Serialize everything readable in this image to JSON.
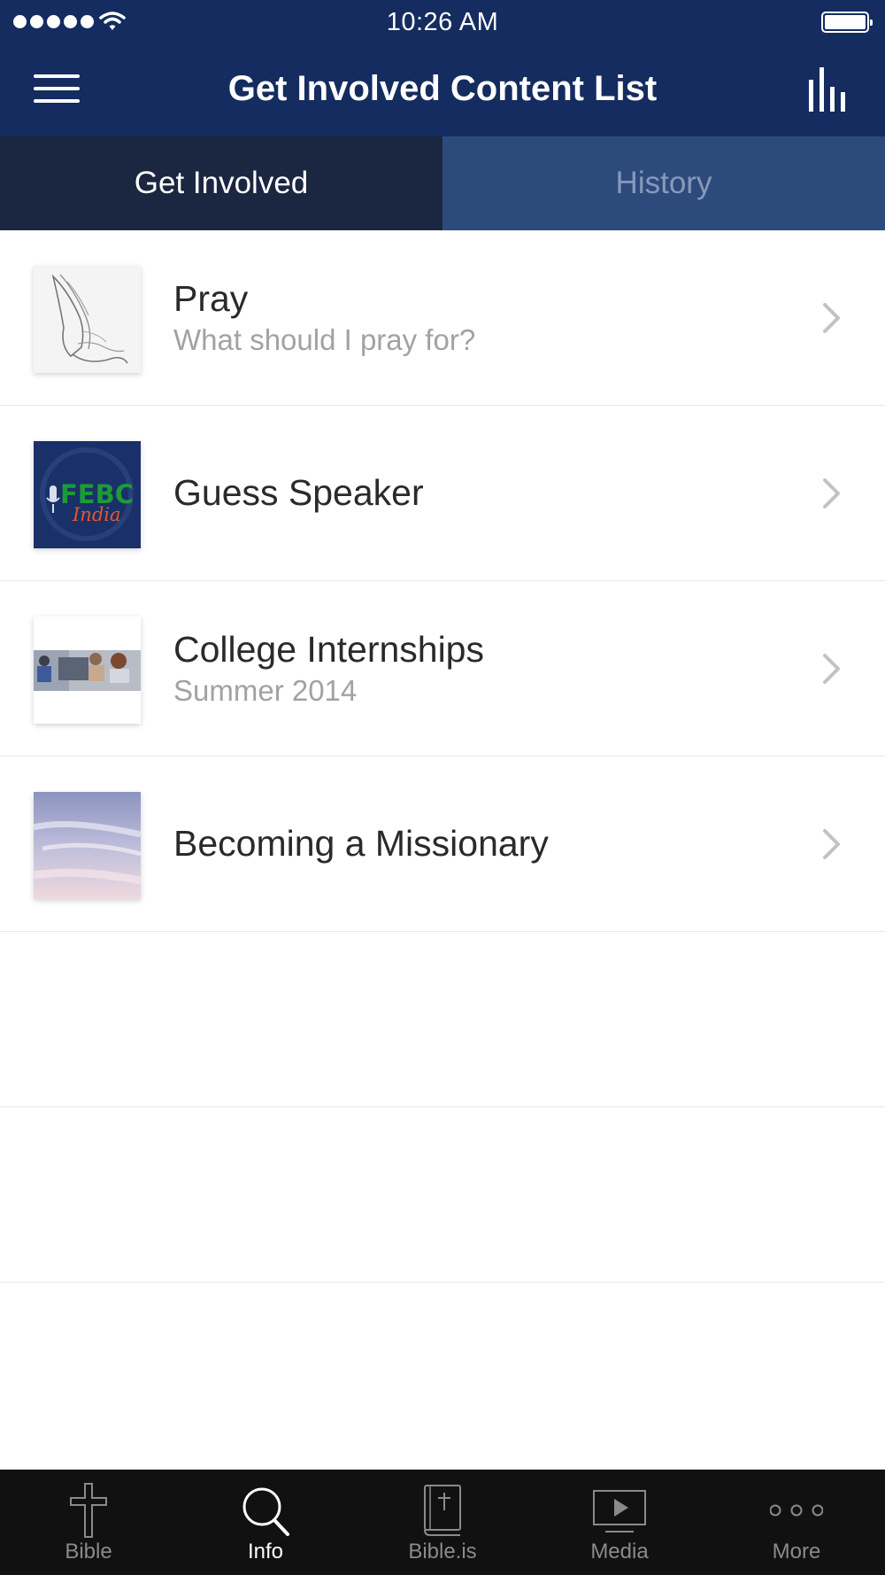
{
  "status_bar": {
    "time": "10:26 AM",
    "signal_icon": "signal-dots-icon",
    "wifi_icon": "wifi-icon",
    "battery_icon": "battery-icon",
    "battery_level": 1.0
  },
  "nav": {
    "title": "Get Involved Content List",
    "menu_icon": "hamburger-menu-icon",
    "stats_icon": "bar-chart-icon"
  },
  "tabs": [
    {
      "label": "Get Involved",
      "active": true
    },
    {
      "label": "History",
      "active": false
    }
  ],
  "items": [
    {
      "title": "Pray",
      "subtitle": "What should I pray for?",
      "thumb": "praying-hands-sketch"
    },
    {
      "title": "Guess Speaker",
      "subtitle": "",
      "thumb": "febc-india-logo",
      "thumb_text_1": "FEBC",
      "thumb_text_2": "India"
    },
    {
      "title": "College Internships",
      "subtitle": "Summer 2014",
      "thumb": "office-workers-photo"
    },
    {
      "title": "Becoming a Missionary",
      "subtitle": "",
      "thumb": "sky-clouds-photo"
    }
  ],
  "tab_bar": [
    {
      "label": "Bible",
      "icon": "cross-icon",
      "selected": false
    },
    {
      "label": "Info",
      "icon": "search-icon",
      "selected": true
    },
    {
      "label": "Bible.is",
      "icon": "bible-book-icon",
      "selected": false
    },
    {
      "label": "Media",
      "icon": "play-video-icon",
      "selected": false
    },
    {
      "label": "More",
      "icon": "more-dots-icon",
      "selected": false
    }
  ],
  "colors": {
    "header": "#142c5f",
    "tab_active": "#1b2641",
    "tab_inactive": "#2d4a7d",
    "tab_bar": "#111111"
  }
}
